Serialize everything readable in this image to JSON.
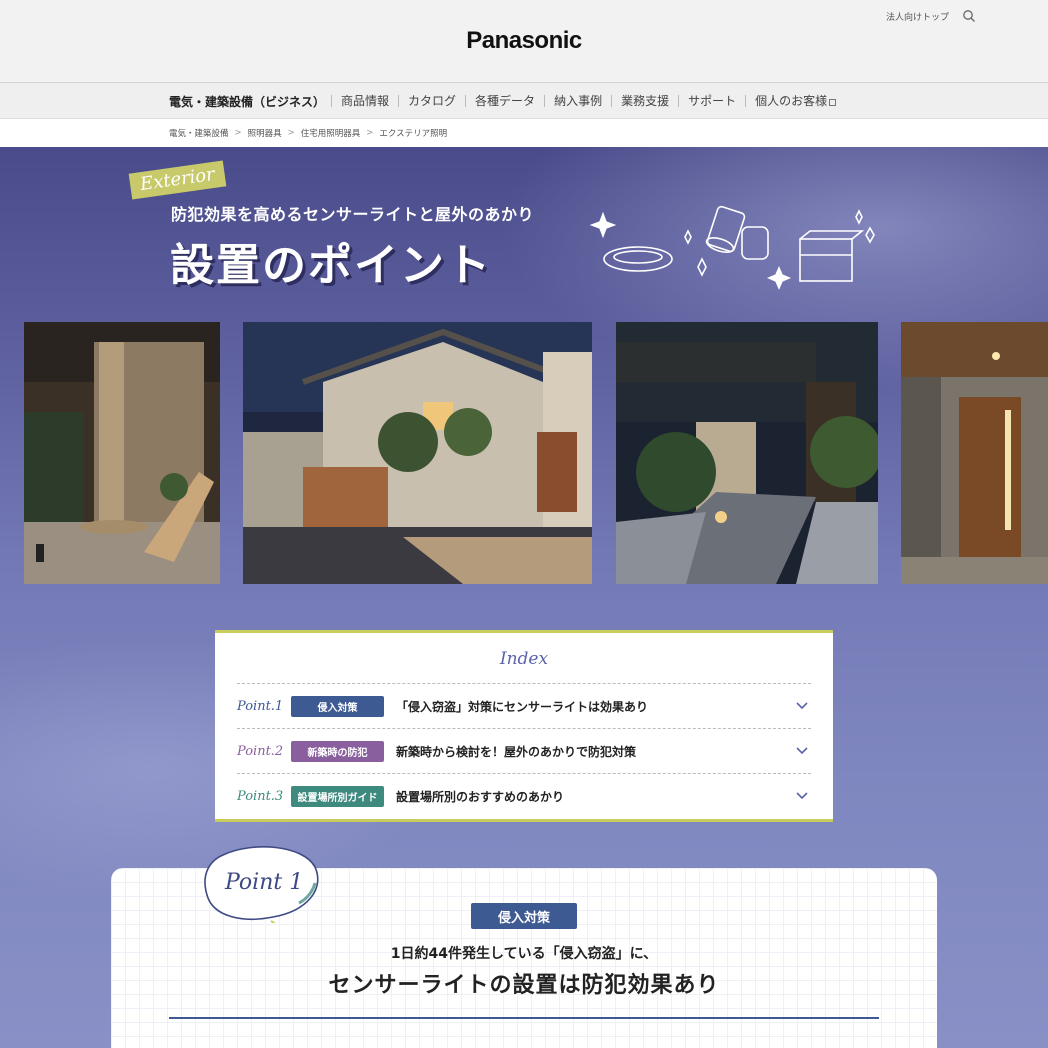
{
  "header": {
    "logo": "Panasonic",
    "util_link": "法人向けトップ",
    "search_icon": "search-icon"
  },
  "gnav": {
    "home": "電気・建築設備（ビジネス）",
    "items": [
      "商品情報",
      "カタログ",
      "各種データ",
      "納入事例",
      "業務支援",
      "サポート",
      "個人のお客様"
    ]
  },
  "breadcrumb": [
    "電気・建築設備",
    "照明器具",
    "住宅用照明器具",
    "エクステリア照明"
  ],
  "hero": {
    "tag": "Exterior",
    "subtitle": "防犯効果を高めるセンサーライトと屋外のあかり",
    "title": "設置のポイント"
  },
  "index": {
    "title": "Index",
    "items": [
      {
        "point": "Point.1",
        "badge": "侵入対策",
        "text": "「侵入窃盗」対策にセンサーライトは効果あり",
        "color": "#3e5a93"
      },
      {
        "point": "Point.2",
        "badge": "新築時の防犯",
        "text": "新築時から検討を！屋外のあかりで防犯対策",
        "color": "#8a5f9e"
      },
      {
        "point": "Point.3",
        "badge": "設置場所別ガイド",
        "text": "設置場所別のおすすめのあかり",
        "color": "#3e8a7e"
      }
    ]
  },
  "point1": {
    "label": "Point 1",
    "badge": "侵入対策",
    "subtitle": "1日約44件発生している「侵入窃盗」に、",
    "title": "センサーライトの設置は防犯効果あり"
  }
}
